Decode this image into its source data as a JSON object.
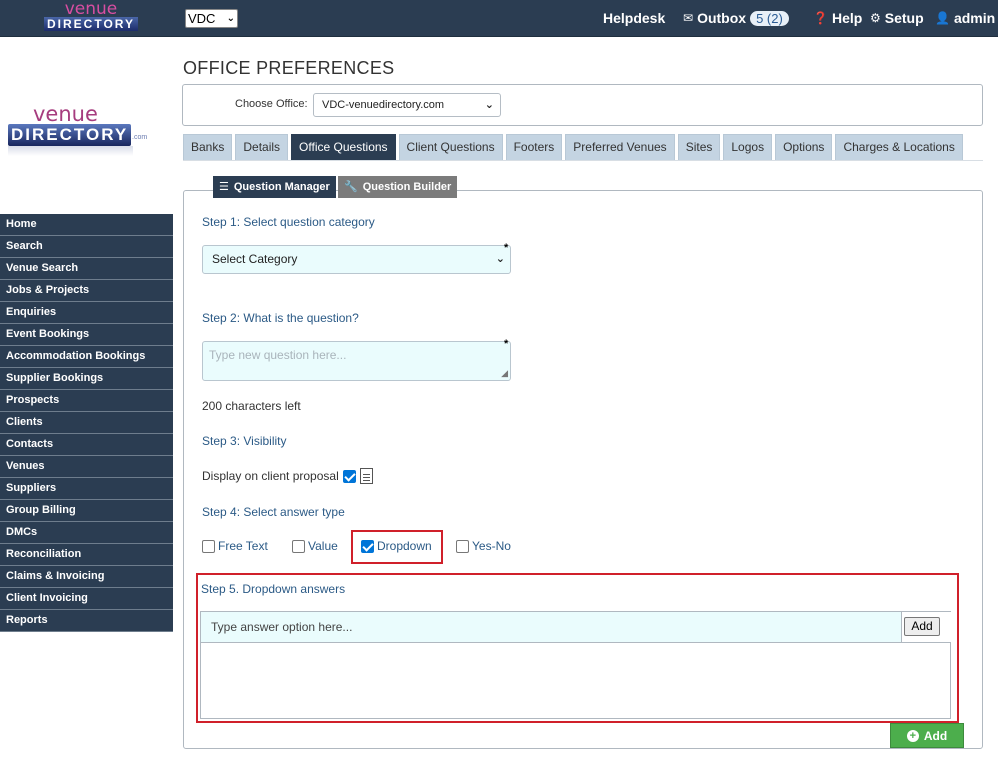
{
  "header": {
    "logo_line1": "venue",
    "logo_line2": "DIRECTORY",
    "org_select": "VDC",
    "helpdesk": "Helpdesk",
    "outbox": "Outbox",
    "outbox_badge": "5 (2)",
    "help": "Help",
    "setup": "Setup",
    "user": "admin"
  },
  "side_logo": {
    "line1": "venue",
    "line2": "DIRECTORY",
    "dotcom": ".com"
  },
  "sidebar": {
    "items": [
      {
        "label": "Home"
      },
      {
        "label": "Search"
      },
      {
        "label": "Venue Search"
      },
      {
        "label": "Jobs & Projects"
      },
      {
        "label": "Enquiries"
      },
      {
        "label": "Event Bookings"
      },
      {
        "label": "Accommodation Bookings"
      },
      {
        "label": "Supplier Bookings"
      },
      {
        "label": "Prospects"
      },
      {
        "label": "Clients"
      },
      {
        "label": "Contacts"
      },
      {
        "label": "Venues"
      },
      {
        "label": "Suppliers"
      },
      {
        "label": "Group Billing"
      },
      {
        "label": "DMCs"
      },
      {
        "label": "Reconciliation"
      },
      {
        "label": "Claims & Invoicing"
      },
      {
        "label": "Client Invoicing"
      },
      {
        "label": "Reports"
      }
    ]
  },
  "main": {
    "title": "OFFICE PREFERENCES",
    "choose_office_label": "Choose Office:",
    "office_value": "VDC-venuedirectory.com",
    "tabs": [
      {
        "label": "Banks",
        "active": false
      },
      {
        "label": "Details",
        "active": false
      },
      {
        "label": "Office Questions",
        "active": true
      },
      {
        "label": "Client Questions",
        "active": false
      },
      {
        "label": "Footers",
        "active": false
      },
      {
        "label": "Preferred Venues",
        "active": false
      },
      {
        "label": "Sites",
        "active": false
      },
      {
        "label": "Logos",
        "active": false
      },
      {
        "label": "Options",
        "active": false
      },
      {
        "label": "Charges & Locations",
        "active": false
      }
    ],
    "subtabs": {
      "question_manager": "Question Manager",
      "question_builder": "Question Builder"
    },
    "form": {
      "step1": "Step 1: Select question category",
      "category_value": "Select Category",
      "step2": "Step 2: What is the question?",
      "question_placeholder": "Type new question here...",
      "chars_left": "200 characters left",
      "step3": "Step 3: Visibility",
      "display_label": "Display on client proposal",
      "display_checked": true,
      "step4": "Step 4: Select answer type",
      "answer_types": [
        {
          "label": "Free Text",
          "checked": false
        },
        {
          "label": "Value",
          "checked": false
        },
        {
          "label": "Dropdown",
          "checked": true
        },
        {
          "label": "Yes-No",
          "checked": false
        }
      ],
      "step5": "Step 5. Dropdown answers",
      "answer_placeholder": "Type answer option here...",
      "answer_add": "Add",
      "add_button": "Add"
    }
  }
}
